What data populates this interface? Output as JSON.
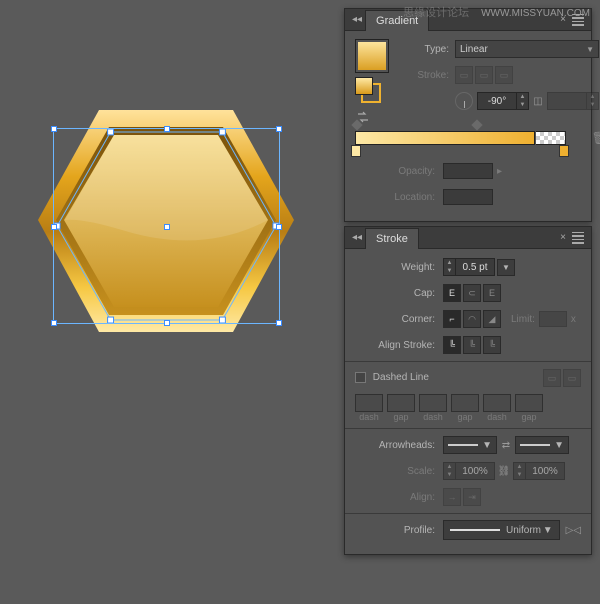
{
  "watermark": {
    "cn": "思缘设计论坛",
    "url": "WWW.MISSYUAN.COM"
  },
  "gradient_panel": {
    "title": "Gradient",
    "type_label": "Type:",
    "type_value": "Linear",
    "stroke_label": "Stroke:",
    "angle_value": "-90°",
    "aspect_value": "",
    "opacity_label": "Opacity:",
    "location_label": "Location:"
  },
  "stroke_panel": {
    "title": "Stroke",
    "weight_label": "Weight:",
    "weight_value": "0.5 pt",
    "cap_label": "Cap:",
    "corner_label": "Corner:",
    "limit_label": "Limit:",
    "limit_x": "x",
    "align_label": "Align Stroke:",
    "dashed_label": "Dashed Line",
    "dash": "dash",
    "gap": "gap",
    "arrowheads_label": "Arrowheads:",
    "scale_label": "Scale:",
    "scale1": "100%",
    "scale2": "100%",
    "align2_label": "Align:",
    "profile_label": "Profile:",
    "profile_value": "Uniform"
  }
}
